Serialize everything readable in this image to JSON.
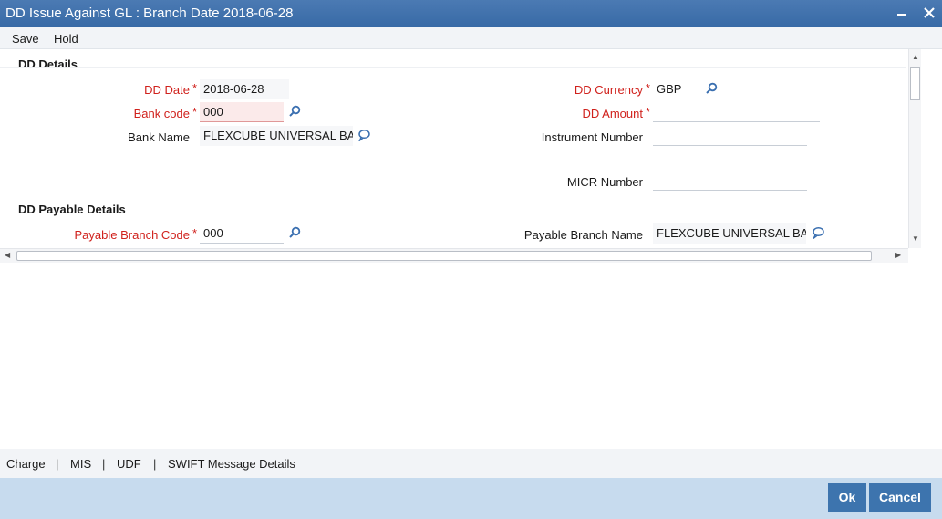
{
  "window": {
    "title": "DD Issue Against GL : Branch Date 2018-06-28",
    "minimize_glyph": "▬",
    "close_glyph": "✕"
  },
  "menu": {
    "save": "Save",
    "hold": "Hold"
  },
  "dd_details": {
    "section_title": "DD Details",
    "dd_date": {
      "label": "DD Date",
      "value": "2018-06-28"
    },
    "bank_code": {
      "label": "Bank code",
      "value": "000"
    },
    "bank_name": {
      "label": "Bank Name",
      "value": "FLEXCUBE UNIVERSAL BA"
    },
    "dd_currency": {
      "label": "DD Currency",
      "value": "GBP"
    },
    "dd_amount": {
      "label": "DD Amount",
      "value": ""
    },
    "instrument_number": {
      "label": "Instrument Number",
      "value": ""
    },
    "micr_number": {
      "label": "MICR Number",
      "value": ""
    }
  },
  "dd_payable_details": {
    "section_title": "DD Payable Details",
    "payable_branch_code": {
      "label": "Payable Branch Code",
      "value": "000"
    },
    "payable_branch_name": {
      "label": "Payable Branch Name",
      "value": "FLEXCUBE UNIVERSAL BA"
    }
  },
  "required_marker": "*",
  "icons": {
    "search": "search-icon",
    "speech": "speech-bubble-icon"
  },
  "bottom_links": {
    "charge": "Charge",
    "mis": "MIS",
    "udf": "UDF",
    "swift": "SWIFT Message Details",
    "separator": "|"
  },
  "footer": {
    "ok": "Ok",
    "cancel": "Cancel"
  },
  "colors": {
    "titlebar": "#386aa6",
    "required": "#d0211c",
    "button": "#3d74ae",
    "footer": "#c7dbee"
  }
}
